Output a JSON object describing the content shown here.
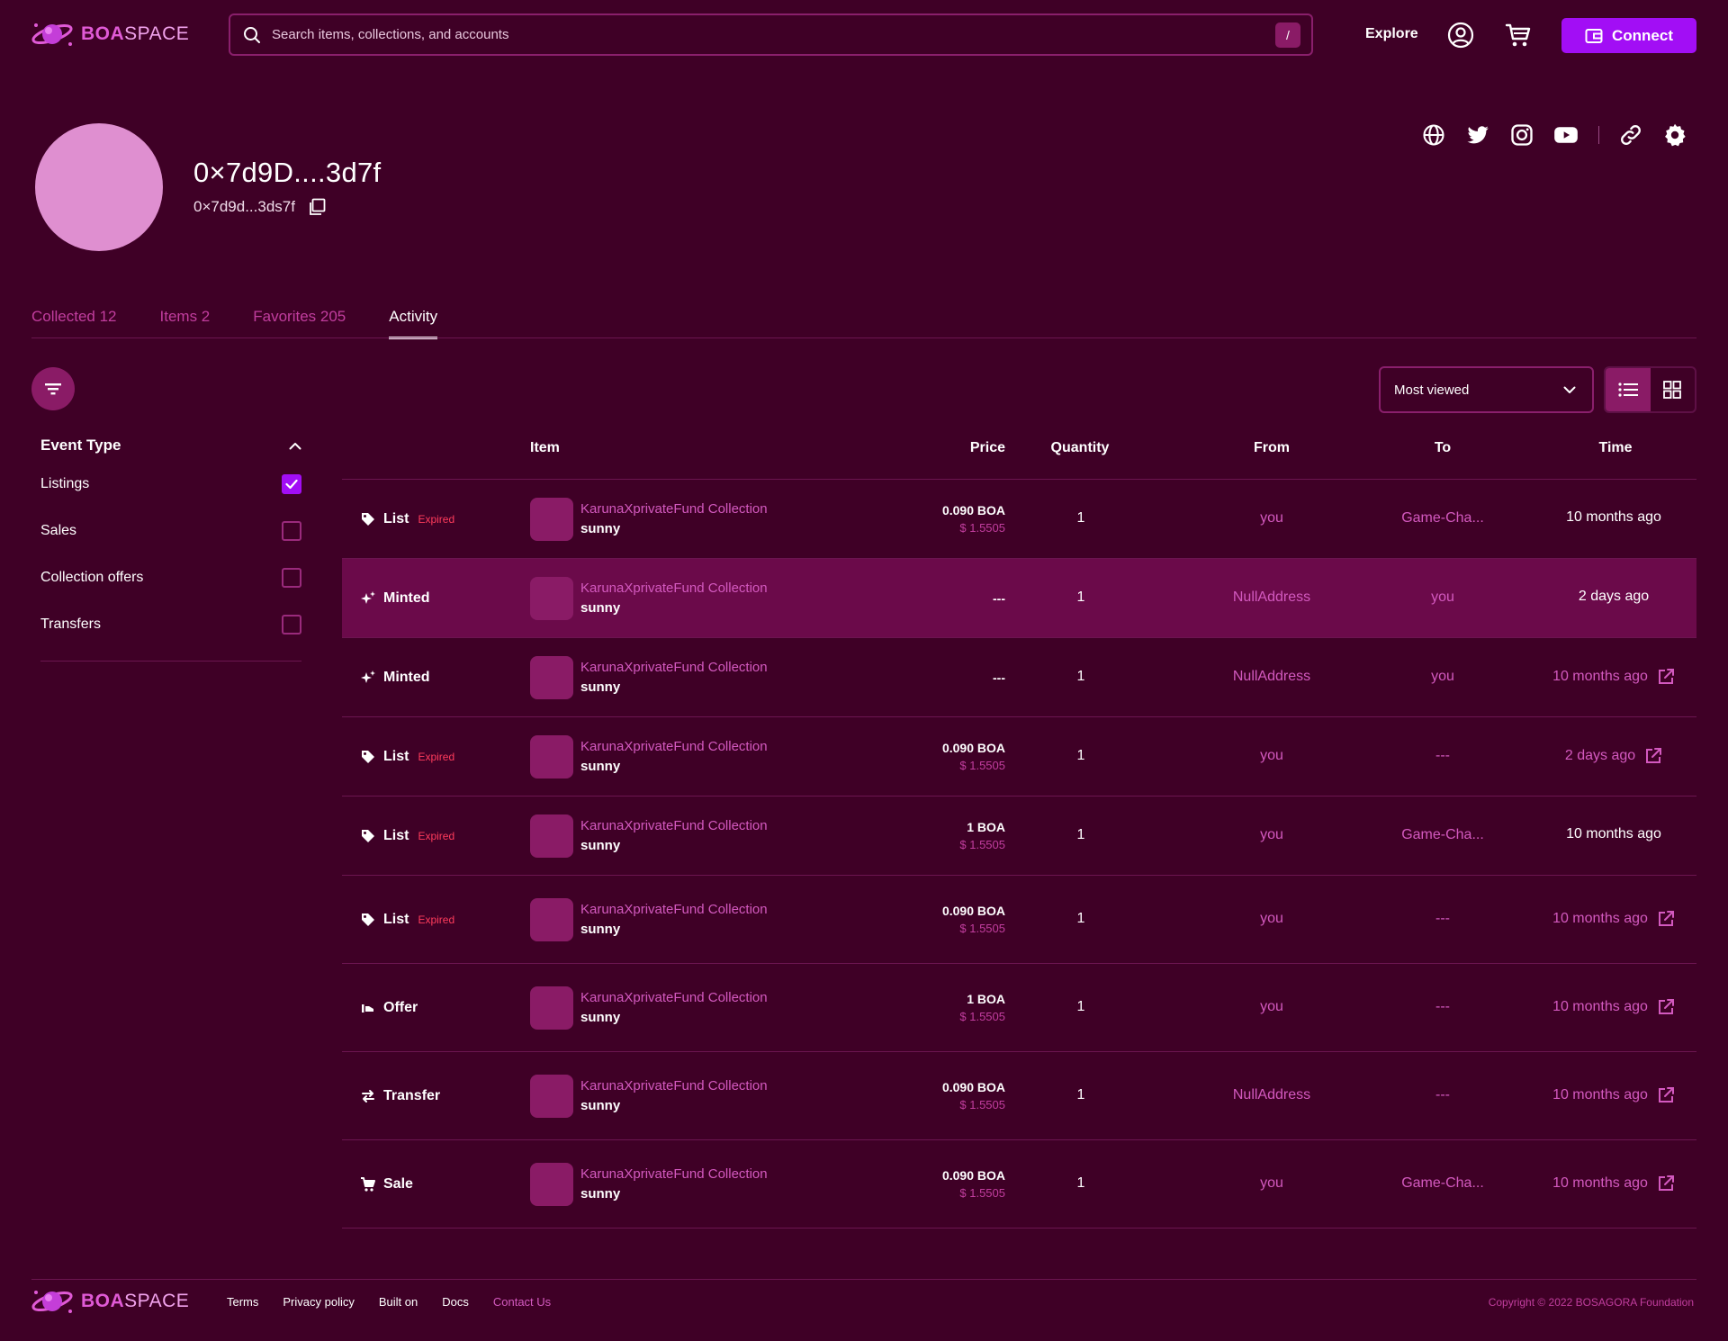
{
  "brand": {
    "name_bold": "BOA",
    "name_light": "SPACE"
  },
  "header": {
    "search_placeholder": "Search items, collections, and accounts",
    "search_shortcut": "/",
    "explore_label": "Explore",
    "connect_label": "Connect"
  },
  "profile": {
    "name": "0×7d9D....3d7f",
    "address": "0×7d9d...3ds7f",
    "social_icons": [
      "globe-icon",
      "twitter-icon",
      "instagram-icon",
      "youtube-icon",
      "link-icon",
      "gear-icon"
    ]
  },
  "tabs": [
    {
      "label": "Collected  12",
      "active": false
    },
    {
      "label": "Items 2",
      "active": false
    },
    {
      "label": "Favorites 205",
      "active": false
    },
    {
      "label": "Activity",
      "active": true
    }
  ],
  "toolbar": {
    "sort_value": "Most viewed"
  },
  "filters": {
    "title": "Event Type",
    "options": [
      {
        "label": "Listings",
        "checked": true
      },
      {
        "label": "Sales",
        "checked": false
      },
      {
        "label": "Collection offers",
        "checked": false
      },
      {
        "label": "Transfers",
        "checked": false
      }
    ]
  },
  "table": {
    "headers": {
      "item": "Item",
      "price": "Price",
      "quantity": "Quantity",
      "from": "From",
      "to": "To",
      "time": "Time"
    },
    "rows": [
      {
        "event": "List",
        "icon": "tag-icon",
        "expired": "Expired",
        "collection": "KarunaXprivateFund Collection",
        "item": "sunny",
        "price": "0.090 BOA",
        "usd": "$ 1.5505",
        "qty": "1",
        "from": "you",
        "to": "Game-Cha...",
        "time": "10 months ago",
        "link": false
      },
      {
        "event": "Minted",
        "icon": "sparkle-icon",
        "expired": "",
        "collection": "KarunaXprivateFund Collection",
        "item": "sunny",
        "price": "---",
        "usd": "",
        "qty": "1",
        "from": "NullAddress",
        "to": "you",
        "time": "2 days ago",
        "link": false,
        "highlight": true
      },
      {
        "event": "Minted",
        "icon": "sparkle-icon",
        "expired": "",
        "collection": "KarunaXprivateFund Collection",
        "item": "sunny",
        "price": "---",
        "usd": "",
        "qty": "1",
        "from": "NullAddress",
        "to": "you",
        "time": "10 months ago",
        "link": true
      },
      {
        "event": "List",
        "icon": "tag-icon",
        "expired": "Expired",
        "collection": "KarunaXprivateFund Collection",
        "item": "sunny",
        "price": "0.090 BOA",
        "usd": "$ 1.5505",
        "qty": "1",
        "from": "you",
        "to": "---",
        "time": "2 days ago",
        "link": true
      },
      {
        "event": "List",
        "icon": "tag-icon",
        "expired": "Expired",
        "collection": "KarunaXprivateFund Collection",
        "item": "sunny",
        "price": "1 BOA",
        "usd": "$ 1.5505",
        "qty": "1",
        "from": "you",
        "to": "Game-Cha...",
        "time": "10 months ago",
        "link": false
      },
      {
        "event": "List",
        "icon": "tag-icon",
        "expired": "Expired",
        "collection": "KarunaXprivateFund Collection",
        "item": "sunny",
        "price": "0.090 BOA",
        "usd": "$ 1.5505",
        "qty": "1",
        "from": "you",
        "to": "---",
        "time": "10 months ago",
        "link": true,
        "tall": true
      },
      {
        "event": "Offer",
        "icon": "offer-icon",
        "expired": "",
        "collection": "KarunaXprivateFund Collection",
        "item": "sunny",
        "price": "1 BOA",
        "usd": "$ 1.5505",
        "qty": "1",
        "from": "you",
        "to": "---",
        "time": "10 months ago",
        "link": true,
        "tall": true
      },
      {
        "event": "Transfer",
        "icon": "transfer-icon",
        "expired": "",
        "collection": "KarunaXprivateFund Collection",
        "item": "sunny",
        "price": "0.090 BOA",
        "usd": "$ 1.5505",
        "qty": "1",
        "from": "NullAddress",
        "to": "---",
        "time": "10 months ago",
        "link": true,
        "tall": true
      },
      {
        "event": "Sale",
        "icon": "cart-icon",
        "expired": "",
        "collection": "KarunaXprivateFund Collection",
        "item": "sunny",
        "price": "0.090 BOA",
        "usd": "$ 1.5505",
        "qty": "1",
        "from": "you",
        "to": "Game-Cha...",
        "time": "10 months ago",
        "link": true,
        "tall": true
      }
    ]
  },
  "footer": {
    "links": [
      "Terms",
      "Privacy policy",
      "Built on",
      "Docs"
    ],
    "contact": "Contact Us",
    "copyright": "Copyright © 2022 BOSAGORA Foundation"
  },
  "colors": {
    "background": "#3f0026",
    "accent": "#a20ef5",
    "link": "#d359bf",
    "expired": "#ff3b5c"
  }
}
